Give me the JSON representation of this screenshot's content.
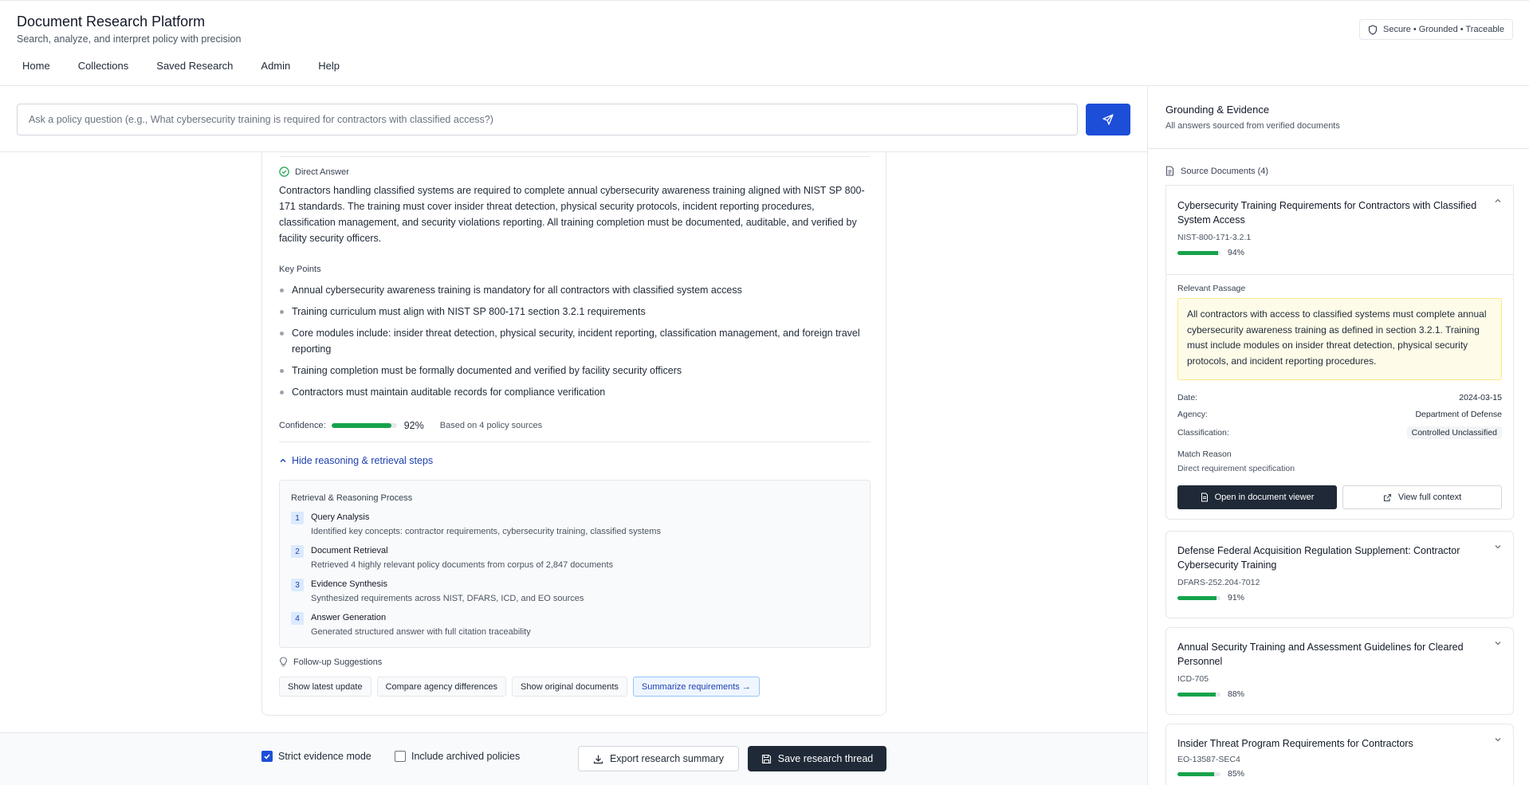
{
  "header": {
    "title": "Document Research Platform",
    "subtitle": "Search, analyze, and interpret policy with precision",
    "badge": "Secure • Grounded • Traceable",
    "nav": [
      "Home",
      "Collections",
      "Saved Research",
      "Admin",
      "Help"
    ]
  },
  "search": {
    "placeholder": "Ask a policy question (e.g., What cybersecurity training is required for contractors with classified access?)",
    "value": ""
  },
  "answer": {
    "direct_label": "Direct Answer",
    "direct_text": "Contractors handling classified systems are required to complete annual cybersecurity awareness training aligned with NIST SP 800-171 standards. The training must cover insider threat detection, physical security protocols, incident reporting procedures, classification management, and security violations reporting. All training completion must be documented, auditable, and verified by facility security officers.",
    "key_points_label": "Key Points",
    "key_points": [
      "Annual cybersecurity awareness training is mandatory for all contractors with classified system access",
      "Training curriculum must align with NIST SP 800-171 section 3.2.1 requirements",
      "Core modules include: insider threat detection, physical security, incident reporting, classification management, and foreign travel reporting",
      "Training completion must be formally documented and verified by facility security officers",
      "Contractors must maintain auditable records for compliance verification"
    ],
    "confidence_label": "Confidence:",
    "confidence_value": "92%",
    "confidence_fraction": 0.92,
    "confidence_note": "Based on 4 policy sources",
    "toggle_reasoning": "Hide reasoning & retrieval steps"
  },
  "reasoning": {
    "title": "Retrieval & Reasoning Process",
    "steps": [
      {
        "num": "1",
        "title": "Query Analysis",
        "desc": "Identified key concepts: contractor requirements, cybersecurity training, classified systems"
      },
      {
        "num": "2",
        "title": "Document Retrieval",
        "desc": "Retrieved 4 highly relevant policy documents from corpus of 2,847 documents"
      },
      {
        "num": "3",
        "title": "Evidence Synthesis",
        "desc": "Synthesized requirements across NIST, DFARS, ICD, and EO sources"
      },
      {
        "num": "4",
        "title": "Answer Generation",
        "desc": "Generated structured answer with full citation traceability"
      }
    ]
  },
  "followup": {
    "label": "Follow-up Suggestions",
    "chips": [
      "Show latest update",
      "Compare agency differences",
      "Show original documents",
      "Summarize requirements →"
    ]
  },
  "bottom": {
    "strict_label": "Strict evidence mode",
    "strict_checked": true,
    "archived_label": "Include archived policies",
    "archived_checked": false,
    "export_label": "Export research summary",
    "save_label": "Save research thread"
  },
  "evidence": {
    "title": "Grounding & Evidence",
    "subtitle": "All answers sourced from verified documents",
    "sources_label": "Source Documents (4)",
    "docs": [
      {
        "title": "Cybersecurity Training Requirements for Contractors with Classified System Access",
        "id": "NIST-800-171-3.2.1",
        "relevance": "94%",
        "relevance_fraction": 0.94
      },
      {
        "title": "Defense Federal Acquisition Regulation Supplement: Contractor Cybersecurity Training",
        "id": "DFARS-252.204-7012",
        "relevance": "91%",
        "relevance_fraction": 0.91
      },
      {
        "title": "Annual Security Training and Assessment Guidelines for Cleared Personnel",
        "id": "ICD-705",
        "relevance": "88%",
        "relevance_fraction": 0.88
      },
      {
        "title": "Insider Threat Program Requirements for Contractors",
        "id": "EO-13587-SEC4",
        "relevance": "85%",
        "relevance_fraction": 0.85
      }
    ],
    "expanded": {
      "passage_label": "Relevant Passage",
      "passage": "All contractors with access to classified systems must complete annual cybersecurity awareness training as defined in section 3.2.1. Training must include modules on insider threat detection, physical security protocols, and incident reporting procedures.",
      "date_label": "Date:",
      "date": "2024-03-15",
      "agency_label": "Agency:",
      "agency": "Department of Defense",
      "classification_label": "Classification:",
      "classification": "Controlled Unclassified",
      "match_label": "Match Reason",
      "match": "Direct requirement specification",
      "open_label": "Open in document viewer",
      "context_label": "View full context"
    }
  },
  "colors": {
    "accent": "#1d4ed8",
    "dark": "#1f2937",
    "success": "#16a34a",
    "highlight": "#fefce8"
  }
}
